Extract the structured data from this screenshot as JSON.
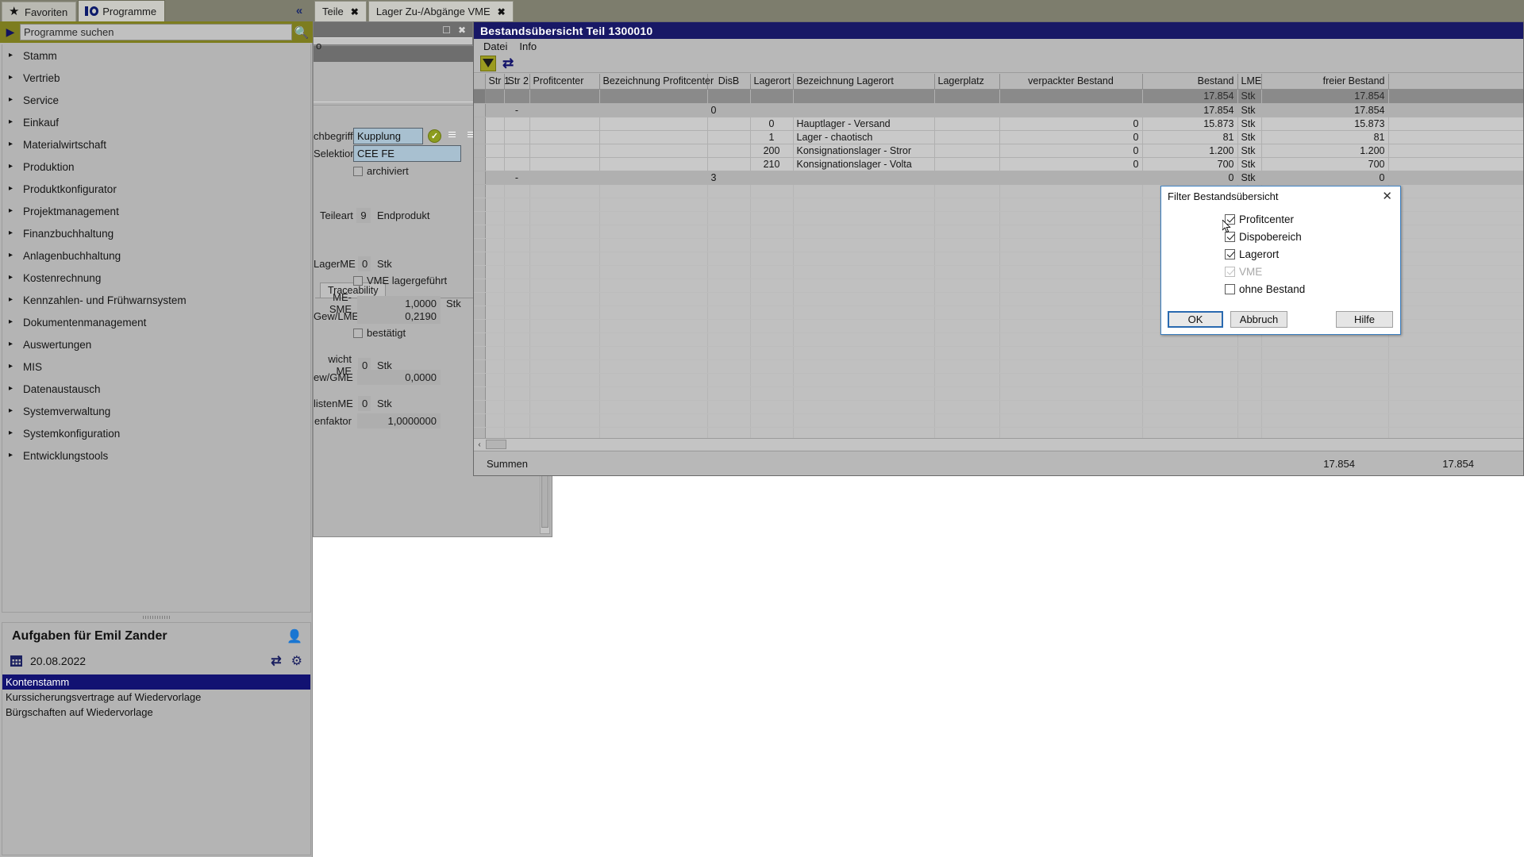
{
  "sidebar": {
    "tabs": [
      {
        "label": "Favoriten",
        "icon": "star-icon",
        "active": false
      },
      {
        "label": "Programme",
        "icon": "programs-icon",
        "active": true
      }
    ],
    "collapse_icon": "chevron-double-left-icon",
    "search": {
      "placeholder": "Programme suchen",
      "value": "Programme suchen",
      "arrow_icon": "play-arrow-icon",
      "search_icon": "magnifier-icon"
    },
    "items": [
      {
        "label": "Stamm"
      },
      {
        "label": "Vertrieb"
      },
      {
        "label": "Service"
      },
      {
        "label": "Einkauf"
      },
      {
        "label": "Materialwirtschaft"
      },
      {
        "label": "Produktion"
      },
      {
        "label": "Produktkonfigurator"
      },
      {
        "label": "Projektmanagement"
      },
      {
        "label": "Finanzbuchhaltung"
      },
      {
        "label": "Anlagenbuchhaltung"
      },
      {
        "label": "Kostenrechnung"
      },
      {
        "label": "Kennzahlen- und Frühwarnsystem"
      },
      {
        "label": "Dokumentenmanagement"
      },
      {
        "label": "Auswertungen"
      },
      {
        "label": "MIS"
      },
      {
        "label": "Datenaustausch"
      },
      {
        "label": "Systemverwaltung"
      },
      {
        "label": "Systemkonfiguration"
      },
      {
        "label": "Entwicklungstools"
      }
    ],
    "tasks": {
      "title": "Aufgaben für Emil Zander",
      "person_icon": "person-icon",
      "date": "20.08.2022",
      "calendar_icon": "calendar-icon",
      "refresh_icon": "refresh-icon",
      "gear_icon": "gear-icon",
      "items": [
        {
          "label": "Kontenstamm",
          "selected": true
        },
        {
          "label": "Kurssicherungsvertrage auf Wiedervorlage",
          "selected": false
        },
        {
          "label": "Bürgschaften auf Wiedervorlage",
          "selected": false
        }
      ]
    }
  },
  "main": {
    "tabs": [
      {
        "label": "Teile",
        "close": "✖"
      },
      {
        "label": "Lager Zu-/Abgänge VME",
        "close": "✖"
      }
    ]
  },
  "teile_window": {
    "maximize_icon": "maximize-icon",
    "close_icon": "close-icon",
    "scrap_text": "o",
    "nav": {
      "first": "first-record-icon",
      "prev": "previous-record-icon",
      "next": "next-record-icon",
      "last": "last-record-icon"
    },
    "fields": {
      "suchbegriff_label": "chbegriff",
      "suchbegriff_value": "Kupplung",
      "selektion_label": "Selektion",
      "selektion_value": "CEE FE",
      "archiviert_label": "archiviert",
      "teileart_label": "Teileart",
      "teileart_code": "9",
      "teileart_text": "Endprodukt",
      "tab_traceability": "Traceability",
      "lagerme_label": "LagerME",
      "lagerme_value": "0",
      "lagerme_unit": "Stk",
      "vme_lagergefuehrt_label": "VME lagergeführt",
      "me_sme_label": "ME-SME",
      "me_sme_value": "1,0000",
      "me_sme_unit": "Stk",
      "gew_lme_label": "Gew/LME",
      "gew_lme_value": "0,2190",
      "bestaetigt_label": "bestätigt",
      "gewicht_me_label": "wicht ME",
      "gewicht_me_value": "0",
      "gewicht_me_unit": "Stk",
      "gew_gme_label": "ew/GME",
      "gew_gme_value": "0,0000",
      "listen_me_label": "listenME",
      "listen_me_value": "0",
      "listen_me_unit": "Stk",
      "enfaktor_label": "enfaktor",
      "enfaktor_value": "1,0000000"
    },
    "icons": {
      "ok_icon": "green-check-icon",
      "doc1_icon": "document-icon",
      "doc2_icon": "document-edit-icon",
      "doc3_icon": "document-add-icon"
    }
  },
  "bestand_window": {
    "title": "Bestandsübersicht Teil 1300010",
    "menu": [
      "Datei",
      "Info"
    ],
    "toolbar": {
      "filter_icon": "filter-icon",
      "refresh_icon": "refresh-icon"
    },
    "table": {
      "columns": [
        "Str 1",
        "Str 2",
        "Profitcenter",
        "Bezeichnung Profitcenter",
        "DisB",
        "Lagerort",
        "Bezeichnung Lagerort",
        "Lagerplatz",
        "verpackter Bestand",
        "Bestand",
        "LME",
        "freier Bestand"
      ],
      "rows": [
        {
          "style": "dark",
          "cells": [
            "",
            "",
            "",
            "",
            "",
            "",
            "",
            "",
            "",
            "17.854",
            "Stk",
            "17.854"
          ]
        },
        {
          "style": "mid",
          "cells": [
            "",
            "-",
            "",
            "",
            "0",
            "",
            "",
            "",
            "",
            "17.854",
            "Stk",
            "17.854"
          ]
        },
        {
          "style": "light",
          "cells": [
            "",
            "",
            "",
            "",
            "",
            "0",
            "Hauptlager - Versand",
            "",
            "0",
            "15.873",
            "Stk",
            "15.873"
          ]
        },
        {
          "style": "light",
          "cells": [
            "",
            "",
            "",
            "",
            "",
            "1",
            "Lager - chaotisch",
            "",
            "0",
            "81",
            "Stk",
            "81"
          ]
        },
        {
          "style": "light",
          "cells": [
            "",
            "",
            "",
            "",
            "",
            "200",
            "Konsignationslager - Stror",
            "",
            "0",
            "1.200",
            "Stk",
            "1.200"
          ]
        },
        {
          "style": "light",
          "cells": [
            "",
            "",
            "",
            "",
            "",
            "210",
            "Konsignationslager - Volta",
            "",
            "0",
            "700",
            "Stk",
            "700"
          ]
        },
        {
          "style": "mid",
          "cells": [
            "",
            "-",
            "",
            "",
            "3",
            "",
            "",
            "",
            "",
            "0",
            "Stk",
            "0"
          ]
        }
      ]
    },
    "summary": {
      "label": "Summen",
      "bestand": "17.854",
      "freier_bestand": "17.854"
    },
    "hscroll": {
      "left_arrow": "‹"
    }
  },
  "filter_dialog": {
    "title": "Filter Bestandsübersicht",
    "close_icon": "close-icon",
    "checkboxes": [
      {
        "label": "Profitcenter",
        "checked": true,
        "disabled": false
      },
      {
        "label": "Dispobereich",
        "checked": true,
        "disabled": false
      },
      {
        "label": "Lagerort",
        "checked": true,
        "disabled": false
      },
      {
        "label": "VME",
        "checked": true,
        "disabled": true
      },
      {
        "label": "ohne Bestand",
        "checked": false,
        "disabled": false
      }
    ],
    "buttons": {
      "ok": "OK",
      "cancel": "Abbruch",
      "help": "Hilfe"
    }
  },
  "colors": {
    "accent_olive": "#7d7d1f",
    "titlebar_blue": "#181866",
    "selection_blue": "#121272",
    "dialog_border": "#3a7ebf"
  }
}
